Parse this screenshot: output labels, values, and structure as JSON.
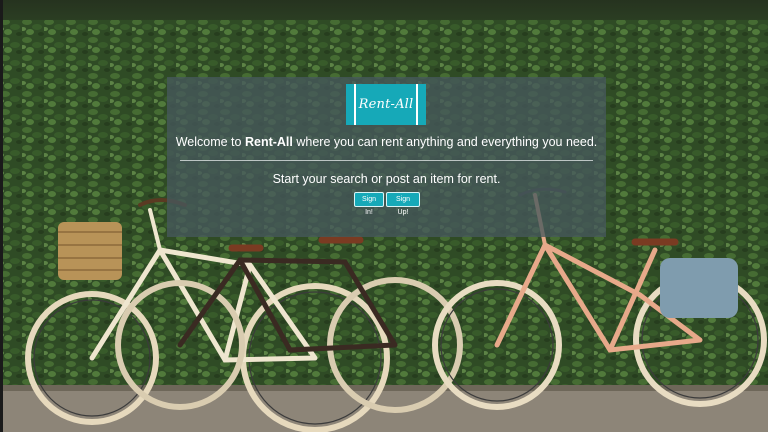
{
  "brand": {
    "logo_text": "Rent-All",
    "accent_color": "#16a9b8"
  },
  "hero": {
    "welcome_prefix": "Welcome to ",
    "welcome_brand": "Rent-All",
    "welcome_suffix": " where you can rent anything and everything you need.",
    "subtitle": "Start your search or post an item for rent."
  },
  "actions": {
    "sign_in_label": "Sign In!",
    "sign_up_label": "Sign Up!"
  },
  "background": {
    "description_icon": "bicycles-against-hedge-photo"
  }
}
